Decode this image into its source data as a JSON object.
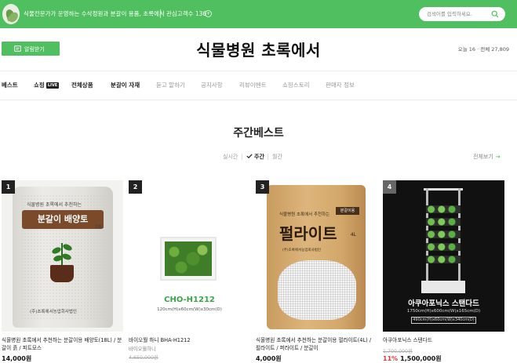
{
  "topbar": {
    "tagline": "식물전문가가 운영하는 수삭정원과 분갈이 용품, 초록에서",
    "interest_label": "관심고객수 136",
    "interest_mark": "+",
    "search_placeholder": "검색어를 입력하세요.",
    "bg_color": "#4fbf5f"
  },
  "header": {
    "alarm_label": "알림받기",
    "site_title": "식물병원 초록에서",
    "visitors": "오늘 16 · 전체 27,809"
  },
  "nav": {
    "items": [
      {
        "label": "베스트",
        "active": true
      },
      {
        "label": "쇼핑",
        "badge": "LIVE",
        "active": true
      },
      {
        "label": "전체상품",
        "active": true
      },
      {
        "label": "분갈이 자재",
        "active": true
      },
      {
        "label": "듣고 맡하기",
        "active": false
      },
      {
        "label": "공지사항",
        "active": false
      },
      {
        "label": "리뷰이벤트",
        "active": false
      },
      {
        "label": "쇼핑스토리",
        "active": false
      },
      {
        "label": "판매자 정보",
        "active": false
      }
    ]
  },
  "best": {
    "title": "주간베스트",
    "periods": [
      "실시간",
      "주간",
      "월간"
    ],
    "active_period": "주간",
    "view_all": "전체보기",
    "view_all_arrow": "→"
  },
  "products": [
    {
      "rank": "1",
      "name": "식물병원 초록에서 추천하는 분갈이용 배양토(18L) / 분갈이 흙 / 피트모스",
      "price": "14,000원",
      "image": {
        "top_text": "식물병원 초록에서 추천하는",
        "label": "분갈이 배양토",
        "volume": "18L",
        "bottom_text": "(주)초록에서농업회사법인"
      }
    },
    {
      "rank": "2",
      "name": "바이오월 하니 BHA-H1212",
      "sub": "바이오월하니",
      "original_price": "4,650,000원",
      "image": {
        "title": "CHO-H1212",
        "size": "120cm(H)x60cm(W)x30cm(D)"
      }
    },
    {
      "rank": "3",
      "name": "식물병원 초록에서 추천하는 분갈이용 펄라이트(4L) / 펄라이트 / 퍼라이트 / 분갈이",
      "price": "4,000원",
      "image": {
        "tag": "분갈이용",
        "top_text": "식물병원 초록에서 추천하는",
        "big": "펄라이트",
        "volume": "4L",
        "info": "(주)초록에서농업회사법인"
      }
    },
    {
      "rank": "4",
      "name": "아쿠아포닉스 스탠다드",
      "original_price": "1,700,000원",
      "discount": "11%",
      "price": "1,500,000원",
      "image": {
        "title": "아쿠아포닉스 스탠다드",
        "size": "1750cm(H)x600cm(W)x165cm(D)",
        "size2": "490cm(H)x60cm(W)x340cm(D)"
      }
    }
  ],
  "colors": {
    "accent": "#4fbf5f",
    "discount": "#e53935"
  }
}
